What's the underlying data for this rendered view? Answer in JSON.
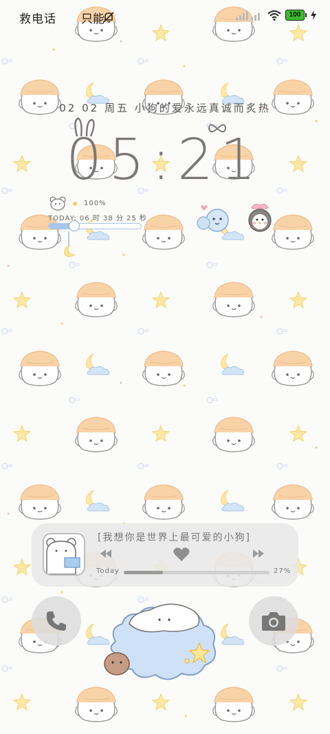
{
  "status_bar": {
    "carrier": "救电话",
    "mode": "只能",
    "battery_level": "100",
    "icons": [
      "mute-bell-icon",
      "signal-icon",
      "wifi-icon",
      "battery-icon",
      "charging-icon"
    ]
  },
  "lockscreen": {
    "date_line": "02 02 周五  小狗的爱永远真诚而炙热",
    "clock": {
      "hours": "05",
      "separator": ":",
      "minutes": "21"
    }
  },
  "day_widget": {
    "battery": "100%",
    "today_time": "TODAY: 06 时 38 分 25 秒",
    "day_progress": 0.27
  },
  "music_widget": {
    "title": "[我想你是世界上最可爱的小狗]",
    "today_label": "Today",
    "percent": "27%",
    "progress": 0.27,
    "icons": [
      "previous-icon",
      "heart-icon",
      "next-icon"
    ]
  },
  "shortcuts": {
    "left_icon": "phone-icon",
    "right_icon": "camera-icon"
  },
  "colors": {
    "accent_orange": "#f7c89b",
    "cloud_blue": "#bcd6f2",
    "star_yellow": "#fbe08a",
    "text_gray": "#7b7778"
  }
}
